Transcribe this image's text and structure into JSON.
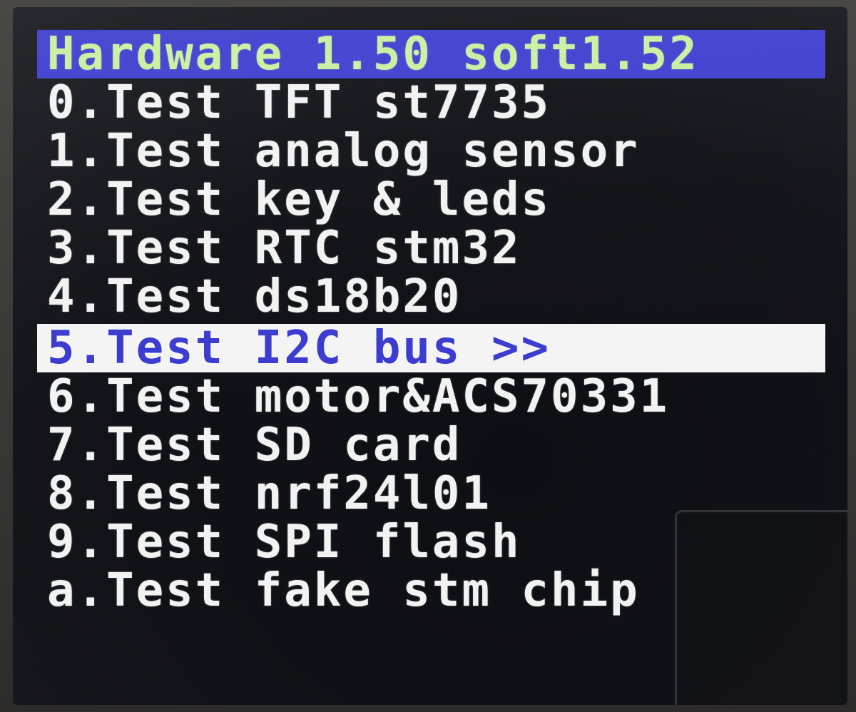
{
  "header": {
    "title": "Hardware 1.50 soft1.52"
  },
  "menu": {
    "items": [
      {
        "label": "0.Test TFT st7735",
        "selected": false
      },
      {
        "label": "1.Test analog sensor",
        "selected": false
      },
      {
        "label": "2.Test key & leds",
        "selected": false
      },
      {
        "label": "3.Test RTC stm32",
        "selected": false
      },
      {
        "label": "4.Test ds18b20",
        "selected": false
      },
      {
        "label": "5.Test I2C bus >>",
        "selected": true
      },
      {
        "label": "6.Test motor&ACS70331",
        "selected": false
      },
      {
        "label": "7.Test SD card",
        "selected": false
      },
      {
        "label": "8.Test nrf24l01",
        "selected": false
      },
      {
        "label": "9.Test SPI flash",
        "selected": false
      },
      {
        "label": "a.Test fake stm chip",
        "selected": false
      }
    ]
  },
  "colors": {
    "header_bg": "#3f3fd0",
    "header_text": "#c8f0a0",
    "selected_bg": "#f4f4f4",
    "selected_text": "#3b3bd0",
    "item_text": "#f2f2f2",
    "screen_bg": "#111217"
  }
}
